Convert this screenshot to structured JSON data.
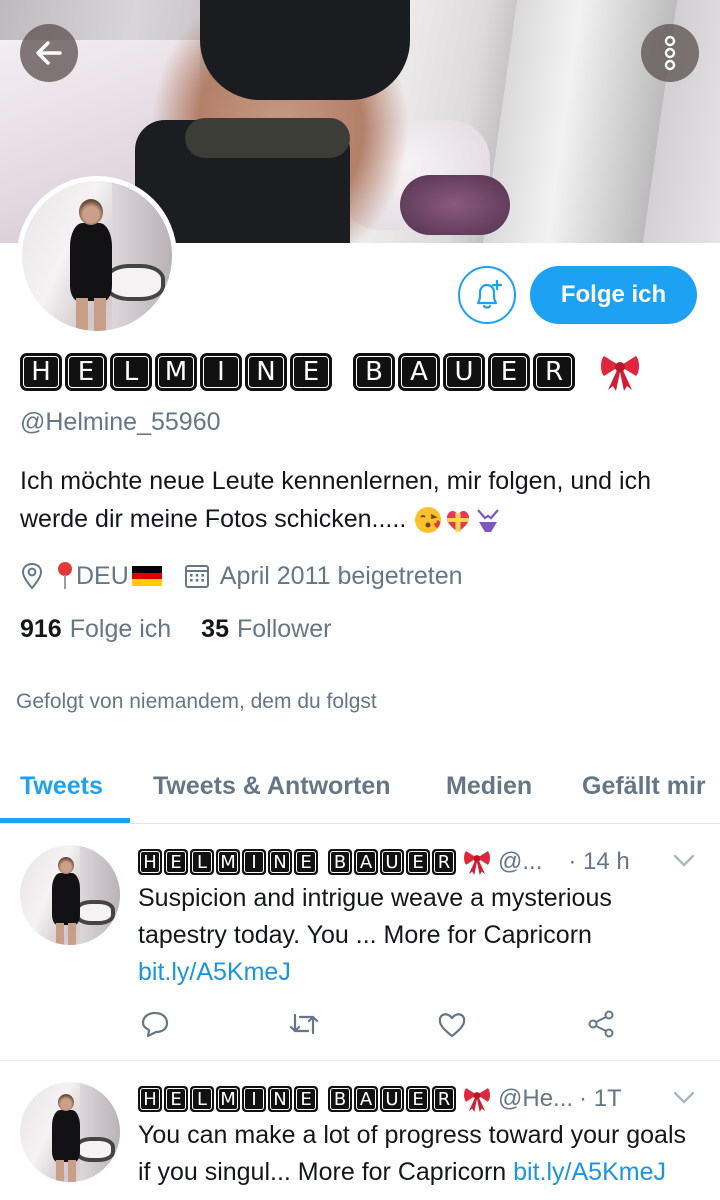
{
  "header": {
    "back_icon": "arrow-left-icon",
    "more_icon": "more-vertical-icon"
  },
  "profile": {
    "display_name_words": [
      [
        "H",
        "E",
        "L",
        "M",
        "I",
        "N",
        "E"
      ],
      [
        "B",
        "A",
        "U",
        "E",
        "R"
      ]
    ],
    "display_name_emoji": "ribbon-bow-emoji",
    "handle": "@Helmine_55960",
    "bio_text": "Ich möchte neue Leute kennenlernen, mir folgen, und ich werde dir meine Fotos schicken.....",
    "bio_emojis": [
      "kiss-emoji",
      "heart-gift-emoji",
      "bikini-emoji"
    ],
    "location": "DEU",
    "location_emojis": [
      "round-pushpin-emoji",
      "germany-flag-emoji"
    ],
    "joined": "April 2011 beigetreten",
    "following_count": "916",
    "following_label": "Folge ich",
    "followers_count": "35",
    "followers_label": "Follower",
    "followed_by": "Gefolgt von niemandem, dem du folgst"
  },
  "actions": {
    "follow_label": "Folge ich",
    "notify_icon": "bell-plus-icon"
  },
  "tabs": [
    {
      "label": "Tweets",
      "active": true
    },
    {
      "label": "Tweets & Antworten",
      "active": false
    },
    {
      "label": "Medien",
      "active": false
    },
    {
      "label": "Gefällt mir",
      "active": false
    }
  ],
  "tweets": [
    {
      "handle": "@...",
      "time": "· 14 h",
      "text": "Suspicion and intrigue weave a mysterious tapestry today. You ... More for Capricorn",
      "link": "bit.ly/A5KmeJ"
    },
    {
      "handle": "@He...",
      "time": "· 1T",
      "text": "You can make a lot of progress toward your goals if you singul... More for Capricorn",
      "link": "bit.ly/A5KmeJ"
    }
  ],
  "colors": {
    "accent": "#1da1f2",
    "muted_text": "#657786",
    "link": "#1b95e0"
  }
}
